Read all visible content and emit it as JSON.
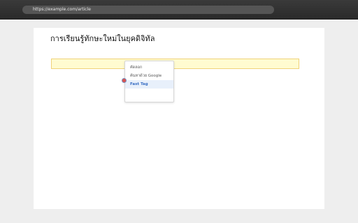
{
  "browser": {
    "url": "https://example.com/article"
  },
  "article": {
    "title": "การเรียนรู้ทักษะใหม่ในยุคดิจิทัล"
  },
  "context_menu": {
    "items": [
      {
        "label": "คัดลอก",
        "active": false
      },
      {
        "label": "ค้นหาด้วย Google",
        "active": false
      },
      {
        "label": "Fast Tag",
        "active": true
      }
    ]
  },
  "colors": {
    "highlight": "#fffbd0",
    "highlight_border": "#f0d27a",
    "menu_active_bg": "#e8f0fb",
    "menu_active_text": "#3a6fc4",
    "cursor": "#d9534f"
  }
}
